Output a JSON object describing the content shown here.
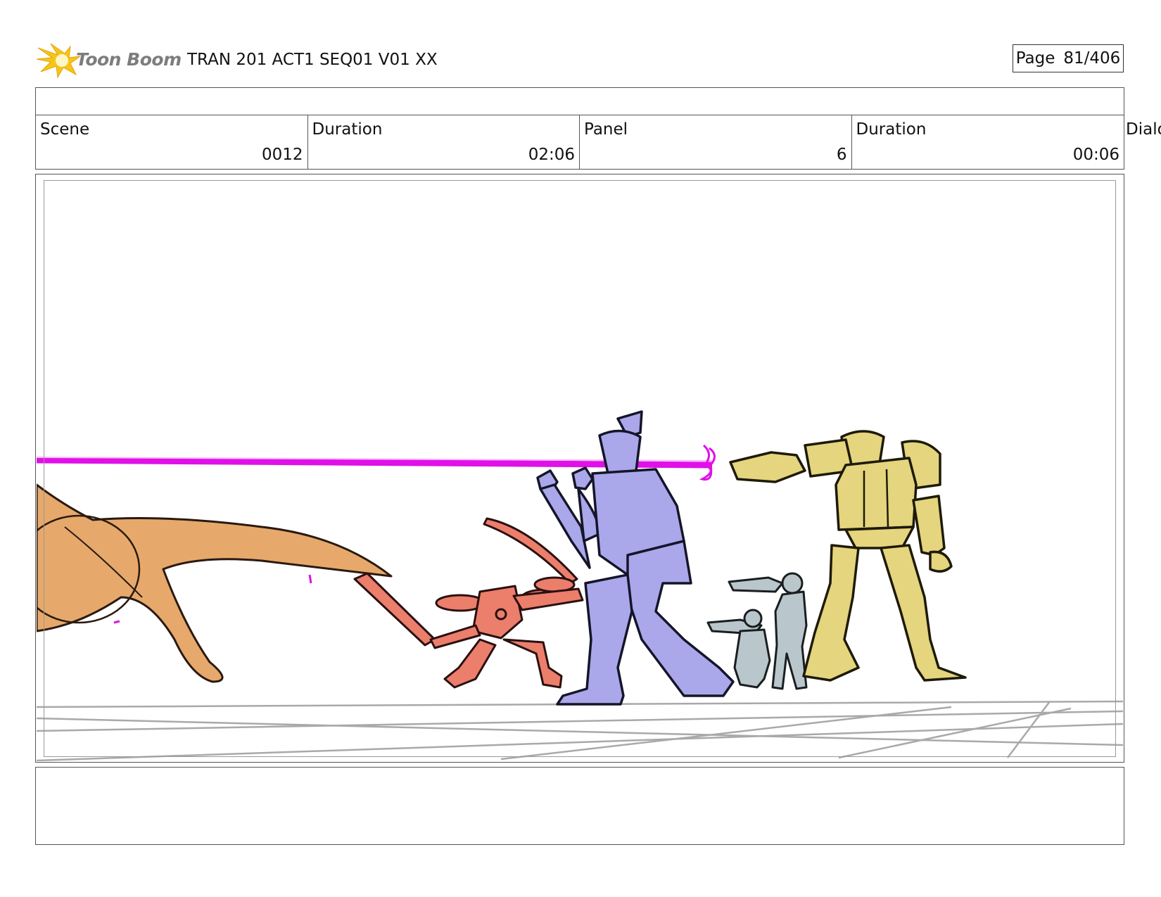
{
  "header": {
    "logo_text": "Toon Boom",
    "title": "TRAN 201 ACT1 SEQ01 V01 XX",
    "page_label": "Page",
    "page_number": "81/406"
  },
  "fields": [
    {
      "label": "Scene",
      "value": "0012"
    },
    {
      "label": "Duration",
      "value": "02:06"
    },
    {
      "label": "Panel",
      "value": "6"
    },
    {
      "label": "Duration",
      "value": "00:06"
    }
  ],
  "clipped_label": "Dialo",
  "colors": {
    "beam": "#e010e8",
    "creature": "#e6a96b",
    "red_robot": "#ec7e6c",
    "purple_robot": "#aaa8ea",
    "grey_figure": "#b9c7cc",
    "yellow_robot": "#e4d57e",
    "logo_star": "#f5c518"
  }
}
